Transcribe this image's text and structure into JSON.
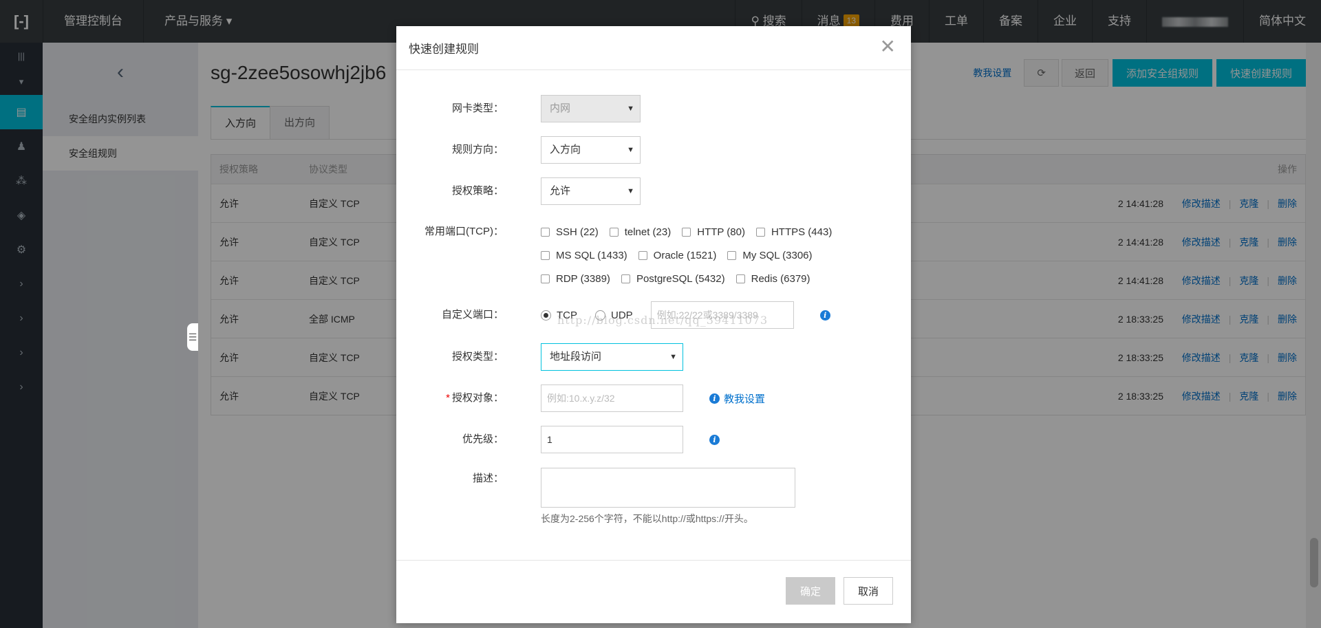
{
  "topbar": {
    "logo": "[-]",
    "console": "管理控制台",
    "products": "产品与服务",
    "search": "搜索",
    "messages": "消息",
    "messages_count": "13",
    "billing": "费用",
    "tickets": "工单",
    "icp": "备案",
    "enterprise": "企业",
    "support": "支持",
    "language": "简体中文"
  },
  "subnav": {
    "back": "‹",
    "items": [
      "安全组内实例列表",
      "安全组规则"
    ]
  },
  "page": {
    "title": "sg-2zee5osowhj2jb6",
    "help_link": "教我设置",
    "back_button": "返回",
    "add_rule_button": "添加安全组规则",
    "quick_create_button": "快速创建规则"
  },
  "tabs": [
    "入方向",
    "出方向"
  ],
  "table": {
    "headers": {
      "policy": "授权策略",
      "protocol": "协议类型",
      "ops": "操作"
    },
    "rows": [
      {
        "policy": "允许",
        "protocol": "自定义 TCP",
        "time": "2 14:41:28"
      },
      {
        "policy": "允许",
        "protocol": "自定义 TCP",
        "time": "2 14:41:28"
      },
      {
        "policy": "允许",
        "protocol": "自定义 TCP",
        "time": "2 14:41:28"
      },
      {
        "policy": "允许",
        "protocol": "全部 ICMP",
        "time": "2 18:33:25"
      },
      {
        "policy": "允许",
        "protocol": "自定义 TCP",
        "time": "2 18:33:25"
      },
      {
        "policy": "允许",
        "protocol": "自定义 TCP",
        "time": "2 18:33:25"
      }
    ],
    "op_edit": "修改描述",
    "op_clone": "克隆",
    "op_delete": "删除"
  },
  "modal": {
    "title": "快速创建规则",
    "nic_label": "网卡类型：",
    "nic_value": "内网",
    "direction_label": "规则方向：",
    "direction_value": "入方向",
    "policy_label": "授权策略：",
    "policy_value": "允许",
    "ports_label": "常用端口(TCP)：",
    "ports": [
      "SSH (22)",
      "telnet (23)",
      "HTTP (80)",
      "HTTPS (443)",
      "MS SQL (1433)",
      "Oracle (1521)",
      "My SQL (3306)",
      "RDP (3389)",
      "PostgreSQL (5432)",
      "Redis (6379)"
    ],
    "custom_port_label": "自定义端口：",
    "tcp": "TCP",
    "udp": "UDP",
    "custom_port_placeholder": "例如:22/22或3389/3389",
    "auth_type_label": "授权类型：",
    "auth_type_value": "地址段访问",
    "auth_obj_label": "授权对象：",
    "auth_obj_placeholder": "例如:10.x.y.z/32",
    "help_link": "教我设置",
    "priority_label": "优先级：",
    "priority_value": "1",
    "desc_label": "描述：",
    "desc_hint": "长度为2-256个字符，不能以http://或https://开头。",
    "ok": "确定",
    "cancel": "取消"
  },
  "watermark": "http://blog.csdn.net/qq_39411073",
  "colors": {
    "accent": "#00c1de",
    "link": "#0070cc",
    "topbar": "#373d41"
  }
}
